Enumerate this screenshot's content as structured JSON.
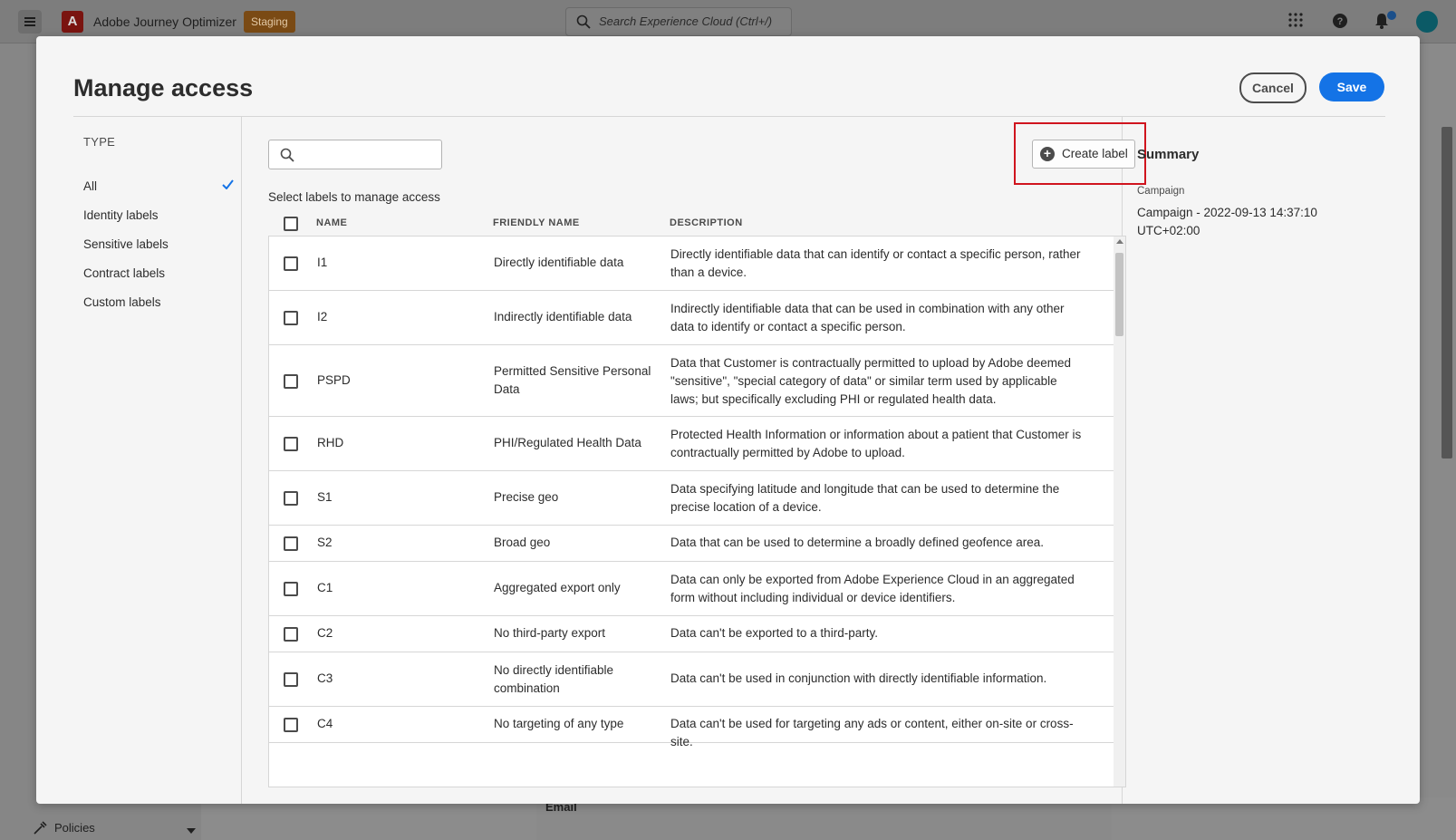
{
  "shell": {
    "app_name": "Adobe Journey Optimizer",
    "env_badge": "Staging",
    "search_placeholder": "Search Experience Cloud (Ctrl+/)",
    "bottom_nav_label": "Policies",
    "behind_label": "Email"
  },
  "modal": {
    "title": "Manage access",
    "cancel_label": "Cancel",
    "save_label": "Save",
    "type_heading": "TYPE",
    "type_items": [
      "All",
      "Identity labels",
      "Sensitive labels",
      "Contract labels",
      "Custom labels"
    ],
    "selected_type": "All",
    "create_label": "Create label",
    "select_hint": "Select labels to manage access",
    "columns": [
      "NAME",
      "FRIENDLY NAME",
      "DESCRIPTION"
    ],
    "rows": [
      {
        "name": "I1",
        "friendly": "Directly identifiable data",
        "desc": "Directly identifiable data that can identify or contact a specific person, rather than a device."
      },
      {
        "name": "I2",
        "friendly": "Indirectly identifiable data",
        "desc": "Indirectly identifiable data that can be used in combination with any other data to identify or contact a specific person."
      },
      {
        "name": "PSPD",
        "friendly": "Permitted Sensitive Personal Data",
        "desc": "Data that Customer is contractually permitted to upload by Adobe deemed \"sensitive\", \"special category of data\" or similar term used by applicable laws; but specifically excluding PHI or regulated health data."
      },
      {
        "name": "RHD",
        "friendly": "PHI/Regulated Health Data",
        "desc": "Protected Health Information or information about a patient that Customer is contractually permitted by Adobe to upload."
      },
      {
        "name": "S1",
        "friendly": "Precise geo",
        "desc": "Data specifying latitude and longitude that can be used to determine the precise location of a device."
      },
      {
        "name": "S2",
        "friendly": "Broad geo",
        "desc": "Data that can be used to determine a broadly defined geofence area."
      },
      {
        "name": "C1",
        "friendly": "Aggregated export only",
        "desc": "Data can only be exported from Adobe Experience Cloud in an aggregated form without including individual or device identifiers."
      },
      {
        "name": "C2",
        "friendly": "No third-party export",
        "desc": "Data can't be exported to a third-party."
      },
      {
        "name": "C3",
        "friendly": "No directly identifiable combination",
        "desc": "Data can't be used in conjunction with directly identifiable information."
      },
      {
        "name": "C4",
        "friendly": "No targeting of any type",
        "desc": "Data can't be used for targeting any ads or content, either on-site or cross-site."
      }
    ],
    "summary": {
      "title": "Summary",
      "kind": "Campaign",
      "text": "Campaign - 2022-09-13 14:37:10 UTC+02:00"
    }
  },
  "colors": {
    "accent": "#1473e6",
    "highlight": "#d0141e"
  }
}
